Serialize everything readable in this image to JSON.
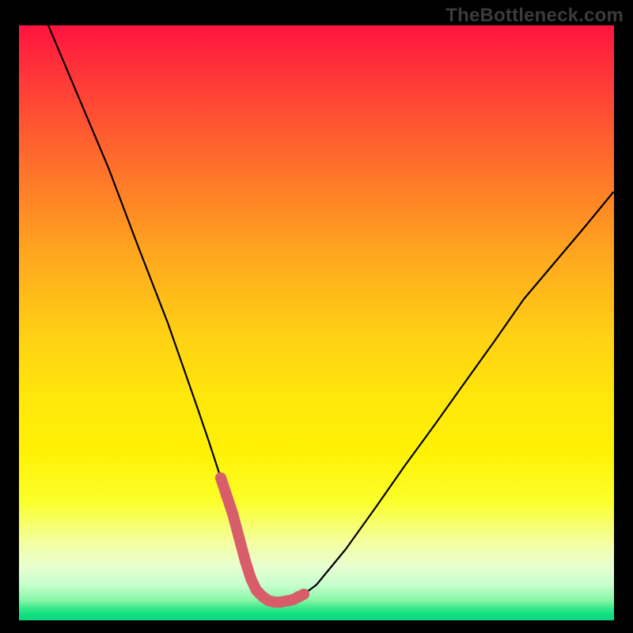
{
  "watermark": "TheBottleneck.com",
  "colors": {
    "frame": "#000000",
    "curve_main": "#000000",
    "curve_highlight": "#d85d6a",
    "gradient_top": "#ff133f",
    "gradient_mid": "#ffe60b",
    "gradient_bottom": "#0fd47f"
  },
  "chart_data": {
    "type": "line",
    "title": "",
    "xlabel": "",
    "ylabel": "",
    "xlim": [
      0,
      100
    ],
    "ylim": [
      0,
      100
    ],
    "x": [
      5,
      10,
      15,
      20,
      25,
      30,
      32,
      34,
      36,
      37,
      38,
      39,
      40,
      41,
      42,
      43,
      44,
      46,
      48,
      50,
      55,
      60,
      65,
      70,
      75,
      80,
      85,
      90,
      95,
      100
    ],
    "series": [
      {
        "name": "bottleneck-curve",
        "values": [
          100,
          88,
          76,
          63,
          50,
          36,
          30,
          24,
          18,
          14,
          10,
          7,
          5,
          4,
          3.2,
          3,
          3,
          3.5,
          4.5,
          6,
          12,
          19,
          26,
          33,
          40,
          47,
          54,
          60,
          66,
          72
        ]
      }
    ],
    "highlight_range_x": [
      34,
      46
    ],
    "annotations": []
  }
}
